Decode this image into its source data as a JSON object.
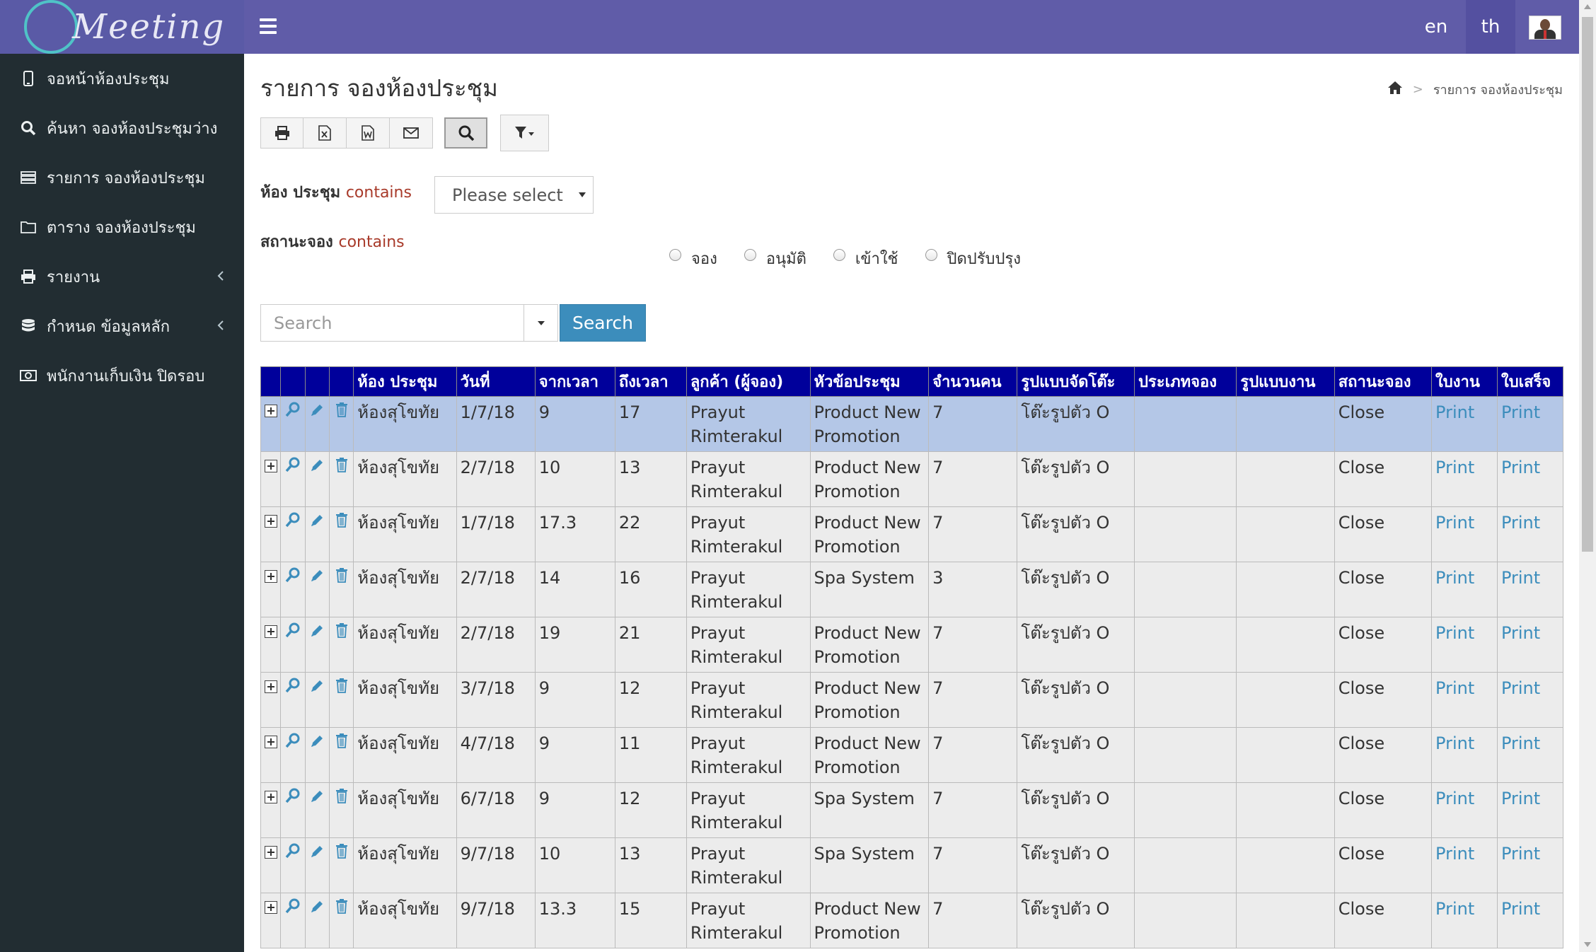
{
  "app": {
    "logo_text": "Meeting"
  },
  "sidebar": {
    "items": [
      {
        "label": "จอหน้าห้องประชุม",
        "icon": "tablet-icon",
        "has_chevron": false
      },
      {
        "label": "ค้นหา จองห้องประชุมว่าง",
        "icon": "search-icon",
        "has_chevron": false
      },
      {
        "label": "รายการ จองห้องประชุม",
        "icon": "list-icon",
        "has_chevron": false
      },
      {
        "label": "ตาราง จองห้องประชุม",
        "icon": "folder-icon",
        "has_chevron": false
      },
      {
        "label": "รายงาน",
        "icon": "print-icon",
        "has_chevron": true
      },
      {
        "label": "กำหนด ข้อมูลหลัก",
        "icon": "database-icon",
        "has_chevron": true
      },
      {
        "label": "พนักงานเก็บเงิน ปิดรอบ",
        "icon": "money-icon",
        "has_chevron": false
      }
    ]
  },
  "topbar": {
    "lang_en": "en",
    "lang_th": "th"
  },
  "page": {
    "title": "รายการ จองห้องประชุม",
    "breadcrumb_current": "รายการ จองห้องประชุม",
    "breadcrumb_sep": ">"
  },
  "filters": {
    "room_label": "ห้อง ประชุม",
    "room_op": "contains",
    "room_select_value": "Please select",
    "status_label": "สถานะจอง",
    "status_op": "contains",
    "status_options": [
      "จอง",
      "อนุมัติ",
      "เข้าใช้",
      "ปิดปรับปรุง"
    ]
  },
  "search": {
    "placeholder": "Search",
    "button_label": "Search"
  },
  "table": {
    "headers": [
      "ห้อง ประชุม",
      "วันที่",
      "จากเวลา",
      "ถึงเวลา",
      "ลูกค้า (ผู้จอง)",
      "หัวข้อประชุม",
      "จำนวนคน",
      "รูปแบบจัดโต๊ะ",
      "ประเภทจอง",
      "รูปแบบงาน",
      "สถานะจอง",
      "ใบงาน",
      "ใบเสร็จ"
    ],
    "rows": [
      {
        "room": "ห้องสุโขทัย",
        "date": "1/7/18",
        "from": "9",
        "to": "17",
        "customer": "Prayut Rimterakul",
        "topic": "Product New Promotion",
        "people": "7",
        "layout": "โต๊ะรูปตัว O",
        "type": "",
        "style": "",
        "status": "Close",
        "worksheet": "Print",
        "receipt": "Print",
        "selected": true
      },
      {
        "room": "ห้องสุโขทัย",
        "date": "2/7/18",
        "from": "10",
        "to": "13",
        "customer": "Prayut Rimterakul",
        "topic": "Product New Promotion",
        "people": "7",
        "layout": "โต๊ะรูปตัว O",
        "type": "",
        "style": "",
        "status": "Close",
        "worksheet": "Print",
        "receipt": "Print"
      },
      {
        "room": "ห้องสุโขทัย",
        "date": "1/7/18",
        "from": "17.3",
        "to": "22",
        "customer": "Prayut Rimterakul",
        "topic": "Product New Promotion",
        "people": "7",
        "layout": "โต๊ะรูปตัว O",
        "type": "",
        "style": "",
        "status": "Close",
        "worksheet": "Print",
        "receipt": "Print"
      },
      {
        "room": "ห้องสุโขทัย",
        "date": "2/7/18",
        "from": "14",
        "to": "16",
        "customer": "Prayut Rimterakul",
        "topic": "Spa System",
        "people": "3",
        "layout": "โต๊ะรูปตัว O",
        "type": "",
        "style": "",
        "status": "Close",
        "worksheet": "Print",
        "receipt": "Print"
      },
      {
        "room": "ห้องสุโขทัย",
        "date": "2/7/18",
        "from": "19",
        "to": "21",
        "customer": "Prayut Rimterakul",
        "topic": "Product New Promotion",
        "people": "7",
        "layout": "โต๊ะรูปตัว O",
        "type": "",
        "style": "",
        "status": "Close",
        "worksheet": "Print",
        "receipt": "Print"
      },
      {
        "room": "ห้องสุโขทัย",
        "date": "3/7/18",
        "from": "9",
        "to": "12",
        "customer": "Prayut Rimterakul",
        "topic": "Product New Promotion",
        "people": "7",
        "layout": "โต๊ะรูปตัว O",
        "type": "",
        "style": "",
        "status": "Close",
        "worksheet": "Print",
        "receipt": "Print"
      },
      {
        "room": "ห้องสุโขทัย",
        "date": "4/7/18",
        "from": "9",
        "to": "11",
        "customer": "Prayut Rimterakul",
        "topic": "Product New Promotion",
        "people": "7",
        "layout": "โต๊ะรูปตัว O",
        "type": "",
        "style": "",
        "status": "Close",
        "worksheet": "Print",
        "receipt": "Print"
      },
      {
        "room": "ห้องสุโขทัย",
        "date": "6/7/18",
        "from": "9",
        "to": "12",
        "customer": "Prayut Rimterakul",
        "topic": "Spa System",
        "people": "7",
        "layout": "โต๊ะรูปตัว O",
        "type": "",
        "style": "",
        "status": "Close",
        "worksheet": "Print",
        "receipt": "Print"
      },
      {
        "room": "ห้องสุโขทัย",
        "date": "9/7/18",
        "from": "10",
        "to": "13",
        "customer": "Prayut Rimterakul",
        "topic": "Spa System",
        "people": "7",
        "layout": "โต๊ะรูปตัว O",
        "type": "",
        "style": "",
        "status": "Close",
        "worksheet": "Print",
        "receipt": "Print"
      },
      {
        "room": "ห้องสุโขทัย",
        "date": "9/7/18",
        "from": "13.3",
        "to": "15",
        "customer": "Prayut Rimterakul",
        "topic": "Product New Promotion",
        "people": "7",
        "layout": "โต๊ะรูปตัว O",
        "type": "",
        "style": "",
        "status": "Close",
        "worksheet": "Print",
        "receipt": "Print"
      }
    ]
  },
  "colors": {
    "topbar": "#605ca8",
    "sidebar": "#222d32",
    "header": "#00009b",
    "row": "#ececec",
    "selected_row": "#b4c7e7",
    "link": "#3c8dbc"
  }
}
